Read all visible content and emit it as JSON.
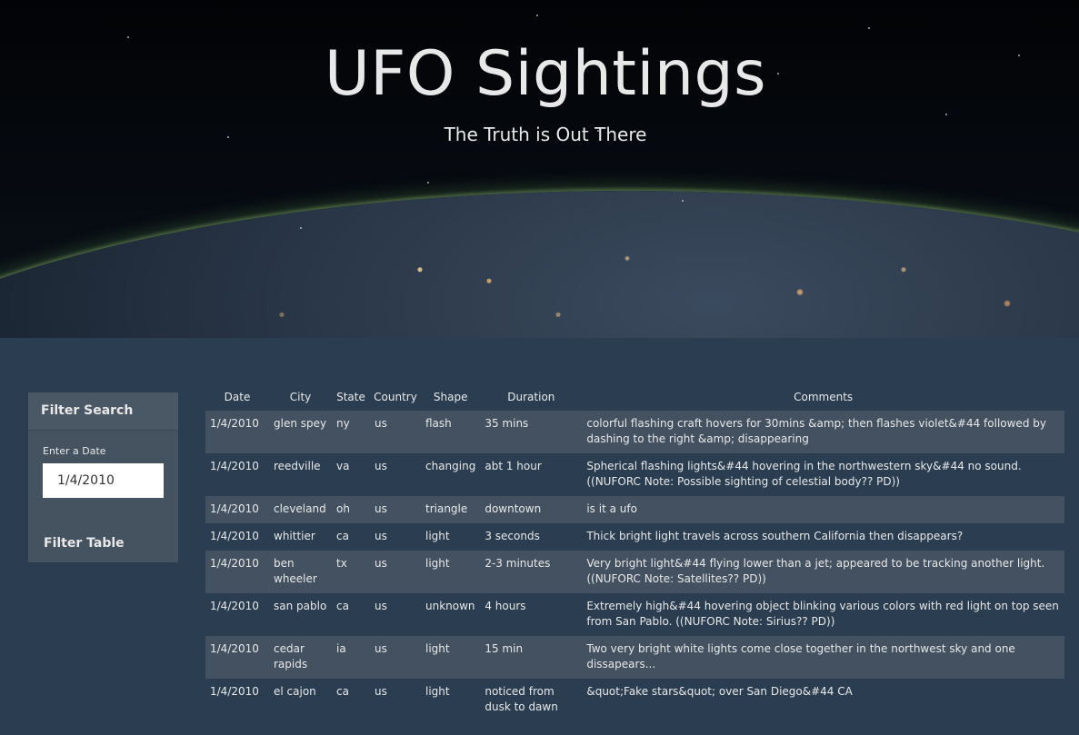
{
  "hero": {
    "title": "UFO Sightings",
    "subtitle": "The Truth is Out There"
  },
  "sidebar": {
    "heading": "Filter Search",
    "date_label": "Enter a Date",
    "date_value": "1/4/2010",
    "filter_button": "Filter Table"
  },
  "table": {
    "headers": [
      "Date",
      "City",
      "State",
      "Country",
      "Shape",
      "Duration",
      "Comments"
    ],
    "rows": [
      {
        "date": "1/4/2010",
        "city": "glen spey",
        "state": "ny",
        "country": "us",
        "shape": "flash",
        "duration": "35 mins",
        "comments": "colorful flashing craft hovers for 30mins &amp; then flashes violet&#44 followed by dashing to the right &amp; disappearing"
      },
      {
        "date": "1/4/2010",
        "city": "reedville",
        "state": "va",
        "country": "us",
        "shape": "changing",
        "duration": "abt 1 hour",
        "comments": "Spherical flashing lights&#44 hovering in the northwestern sky&#44 no sound. ((NUFORC Note: Possible sighting of celestial body?? PD))"
      },
      {
        "date": "1/4/2010",
        "city": "cleveland",
        "state": "oh",
        "country": "us",
        "shape": "triangle",
        "duration": "downtown",
        "comments": "is it a ufo"
      },
      {
        "date": "1/4/2010",
        "city": "whittier",
        "state": "ca",
        "country": "us",
        "shape": "light",
        "duration": "3 seconds",
        "comments": "Thick bright light travels across southern California then disappears?"
      },
      {
        "date": "1/4/2010",
        "city": "ben wheeler",
        "state": "tx",
        "country": "us",
        "shape": "light",
        "duration": "2-3 minutes",
        "comments": "Very bright light&#44 flying lower than a jet; appeared to be tracking another light. ((NUFORC Note: Satellites?? PD))"
      },
      {
        "date": "1/4/2010",
        "city": "san pablo",
        "state": "ca",
        "country": "us",
        "shape": "unknown",
        "duration": "4 hours",
        "comments": "Extremely high&#44 hovering object blinking various colors with red light on top seen from San Pablo. ((NUFORC Note: Sirius?? PD))"
      },
      {
        "date": "1/4/2010",
        "city": "cedar rapids",
        "state": "ia",
        "country": "us",
        "shape": "light",
        "duration": "15 min",
        "comments": "Two very bright white lights come close together in the northwest sky and one dissapears..."
      },
      {
        "date": "1/4/2010",
        "city": "el cajon",
        "state": "ca",
        "country": "us",
        "shape": "light",
        "duration": "noticed from dusk to dawn",
        "comments": "&quot;Fake stars&quot; over San Diego&#44 CA"
      }
    ]
  }
}
